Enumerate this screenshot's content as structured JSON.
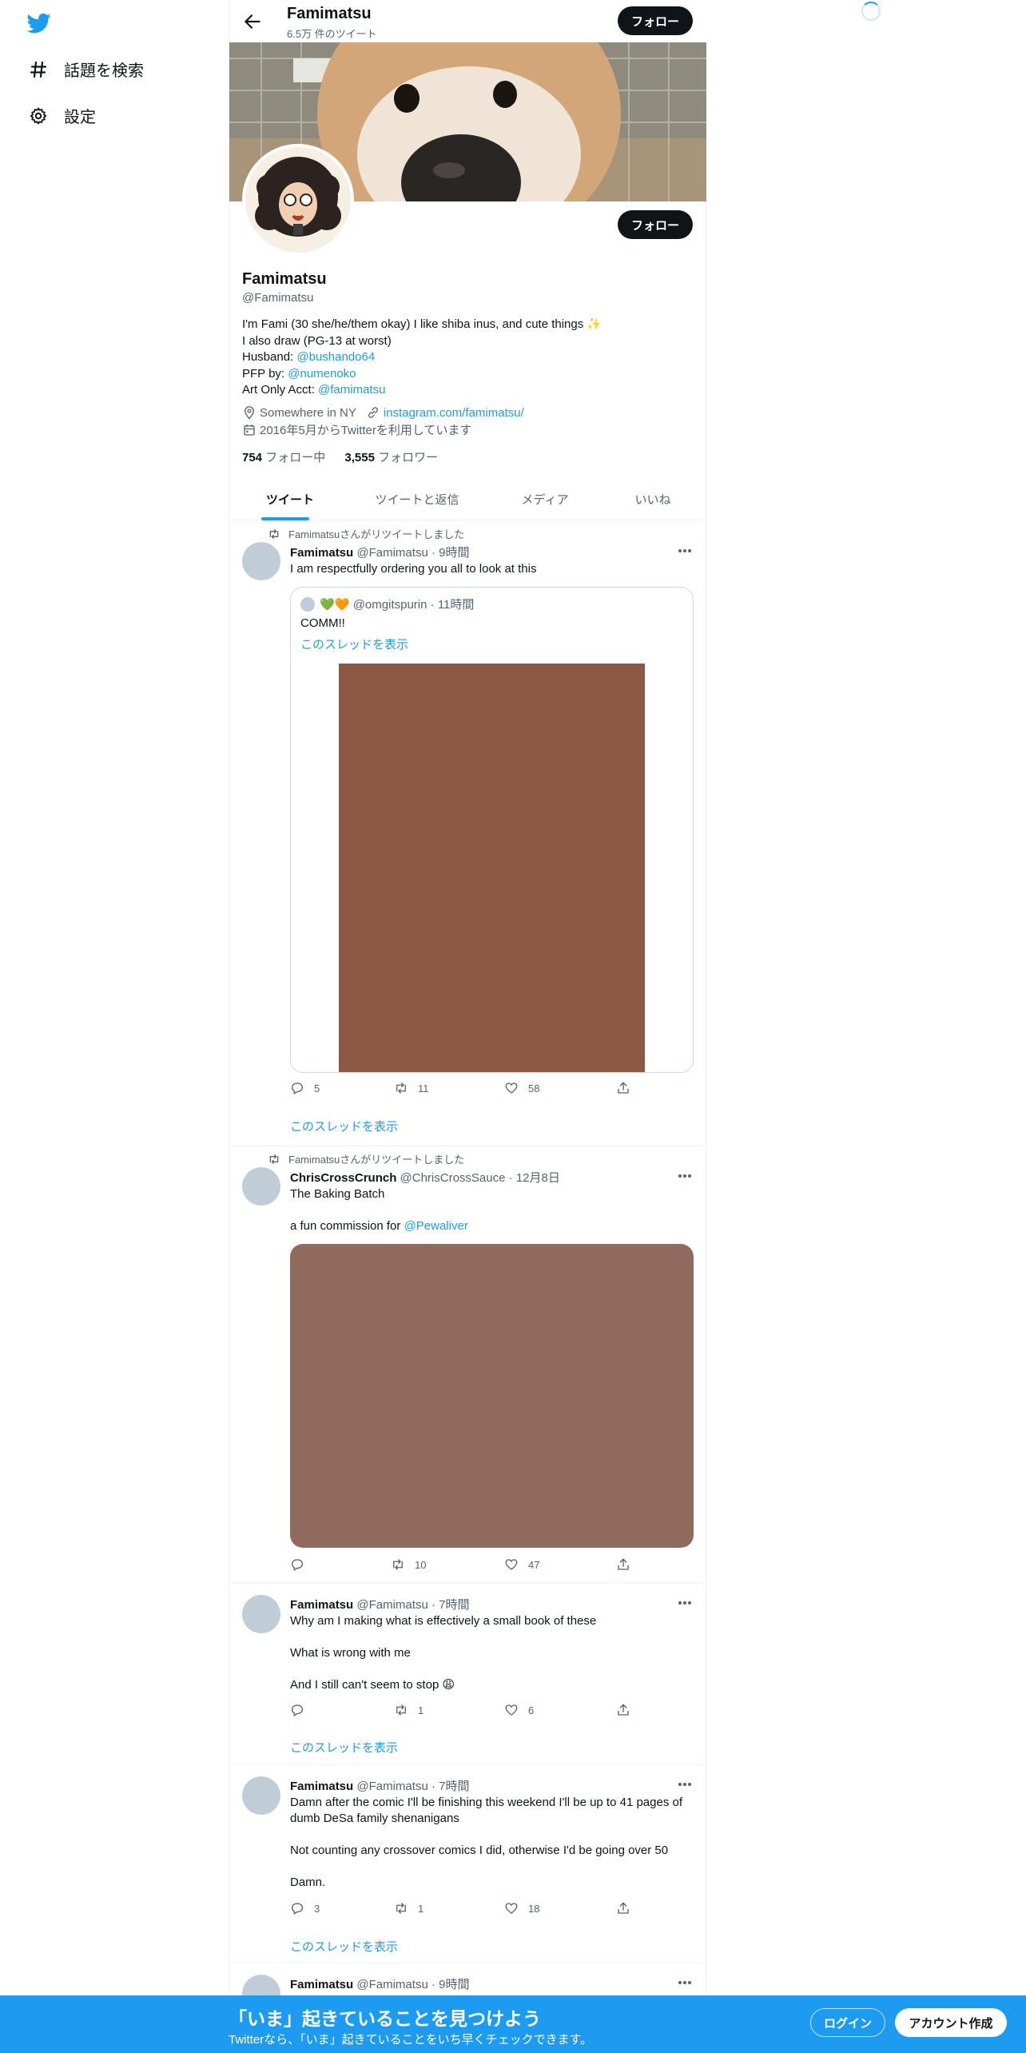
{
  "nav": {
    "explore_label": "話題を検索",
    "settings_label": "設定"
  },
  "header": {
    "title": "Famimatsu",
    "tweet_count": "6.5万 件のツイート",
    "follow_label": "フォロー"
  },
  "profile": {
    "name": "Famimatsu",
    "handle": "@Famimatsu",
    "follow_label": "フォロー",
    "bio_line1": "I'm Fami (30 she/he/them okay) I like shiba inus, and cute things ✨",
    "bio_line2": "I also draw (PG-13 at worst)",
    "bio_husband_prefix": "Husband: ",
    "bio_husband_link": "@bushando64",
    "bio_pfp_prefix": "PFP by: ",
    "bio_pfp_link": "@numenoko",
    "bio_art_prefix": "Art Only Acct: ",
    "bio_art_link": "@famimatsu",
    "location": "Somewhere in NY",
    "website": "instagram.com/famimatsu/",
    "joined": "2016年5月からTwitterを利用しています",
    "following_count": "754",
    "following_label": " フォロー中",
    "followers_count": "3,555",
    "followers_label": " フォロワー"
  },
  "tabs": [
    {
      "label": "ツイート"
    },
    {
      "label": "ツイートと返信"
    },
    {
      "label": "メディア"
    },
    {
      "label": "いいね"
    }
  ],
  "tweets": [
    {
      "retweet_label": "Famimatsuさんがリツイートしました",
      "name": "Famimatsu",
      "handle": "@Famimatsu",
      "time": "9時間",
      "text": "I am respectfully ordering you all to look at this",
      "quote": {
        "emoji": "💚🧡",
        "handle": "@omgitspurin",
        "time": "11時間",
        "text": "COMM!!",
        "thread_link": "このスレッドを表示",
        "image_color": "#8c5844"
      },
      "replies": "5",
      "retweets": "11",
      "likes": "58",
      "thread_link": "このスレッドを表示"
    },
    {
      "retweet_label": "Famimatsuさんがリツイートしました",
      "name": "ChrisCrossCrunch",
      "handle": "@ChrisCrossSauce",
      "time": "12月8日",
      "text_line1": "The Baking Batch",
      "text_line2_prefix": "a fun commission for ",
      "text_line2_link": "@Pewaliver",
      "image_color": "#916a5e",
      "replies": "",
      "retweets": "10",
      "likes": "47"
    },
    {
      "name": "Famimatsu",
      "handle": "@Famimatsu",
      "time": "7時間",
      "text_line1": "Why am I making what is effectively a small book of these",
      "text_line2": "What is wrong with me",
      "text_line3": "And I still can't seem to stop 😩",
      "replies": "",
      "retweets": "1",
      "likes": "6",
      "thread_link": "このスレッドを表示"
    },
    {
      "name": "Famimatsu",
      "handle": "@Famimatsu",
      "time": "7時間",
      "text_line1": "Damn after the comic I'll be finishing this weekend I'll be up to 41 pages of dumb DeSa family shenanigans",
      "text_line2": "Not counting any crossover comics I did, otherwise I'd be going over 50",
      "text_line3": "Damn.",
      "replies": "3",
      "retweets": "1",
      "likes": "18",
      "thread_link": "このスレッドを表示"
    },
    {
      "name": "Famimatsu",
      "handle": "@Famimatsu",
      "time": "9時間"
    }
  ],
  "bottom_bar": {
    "title": "「いま」起きていることを見つけよう",
    "subtitle": "Twitterなら、「いま」起きていることをいち早くチェックできます。",
    "login_label": "ログイン",
    "signup_label": "アカウント作成"
  }
}
